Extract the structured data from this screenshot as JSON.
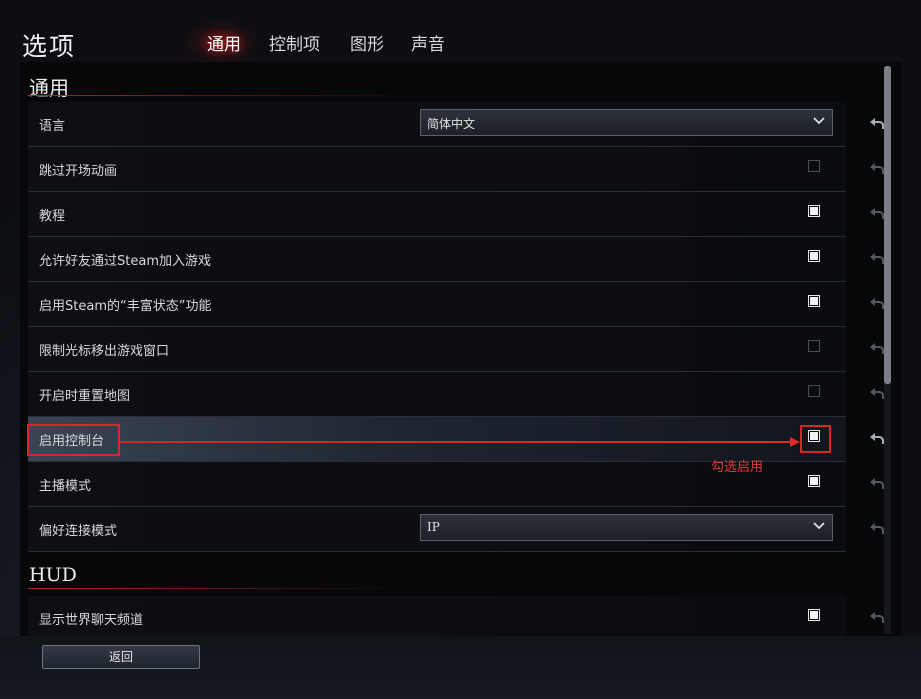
{
  "title": "选项",
  "tabs": [
    {
      "label": "通用",
      "active": true
    },
    {
      "label": "控制项",
      "active": false
    },
    {
      "label": "图形",
      "active": false
    },
    {
      "label": "声音",
      "active": false
    }
  ],
  "sections": {
    "general": {
      "title": "通用",
      "rows": [
        {
          "label": "语言",
          "type": "dropdown",
          "value": "简体中文"
        },
        {
          "label": "跳过开场动画",
          "type": "checkbox",
          "checked": false
        },
        {
          "label": "教程",
          "type": "checkbox",
          "checked": true
        },
        {
          "label": "允许好友通过Steam加入游戏",
          "type": "checkbox",
          "checked": true
        },
        {
          "label": "启用Steam的“丰富状态”功能",
          "type": "checkbox",
          "checked": true
        },
        {
          "label": "限制光标移出游戏窗口",
          "type": "checkbox",
          "checked": false
        },
        {
          "label": "开启时重置地图",
          "type": "checkbox",
          "checked": false
        },
        {
          "label": "启用控制台",
          "type": "checkbox",
          "checked": true
        },
        {
          "label": "主播模式",
          "type": "checkbox",
          "checked": true
        },
        {
          "label": "偏好连接模式",
          "type": "dropdown",
          "value": "IP"
        }
      ]
    },
    "hud": {
      "title": "HUD",
      "rows": [
        {
          "label": "显示世界聊天频道",
          "type": "checkbox",
          "checked": true
        }
      ]
    }
  },
  "annotation": {
    "text": "勾选启用",
    "color": "#d8262b"
  },
  "footer": {
    "back_label": "返回"
  },
  "icons": {
    "reset": "undo-arrow-icon",
    "dropdown": "chevron-down-icon",
    "tab_highlight_color": "#c81e1e"
  }
}
